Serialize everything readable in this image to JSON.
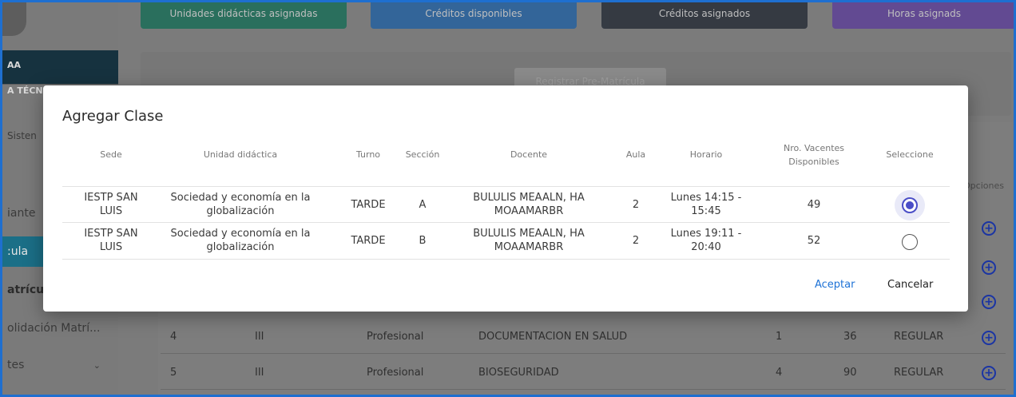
{
  "sidebar": {
    "user_name": "AA",
    "user_role": "A TÉCN",
    "system_label": "Sisten",
    "items": [
      {
        "label": "iante"
      },
      {
        "label": ":ula"
      },
      {
        "label": "atrícu"
      },
      {
        "label": "olidación Matrí..."
      },
      {
        "label": "tes"
      }
    ]
  },
  "header_cards": [
    {
      "label": "Unidades didácticas asignadas",
      "color": "#0f6b53"
    },
    {
      "label": "Créditos disponibles",
      "color": "#1b5ea3"
    },
    {
      "label": "Créditos asignados",
      "color": "#1e2530"
    },
    {
      "label": "Horas asignads",
      "color": "#5a3a9a"
    }
  ],
  "register_button": "Registrar Pre-Matrícula",
  "background_table": {
    "options_header": "Opciones",
    "rows": [
      {
        "n": "4",
        "ciclo": "III",
        "tipo": "Profesional",
        "nombre": "DOCUMENTACION EN SALUD",
        "cred": "1",
        "horas": "36",
        "estado": "REGULAR"
      },
      {
        "n": "5",
        "ciclo": "III",
        "tipo": "Profesional",
        "nombre": "BIOSEGURIDAD",
        "cred": "4",
        "horas": "90",
        "estado": "REGULAR"
      }
    ]
  },
  "modal": {
    "title": "Agregar Clase",
    "headers": {
      "sede": "Sede",
      "unidad": "Unidad didáctica",
      "turno": "Turno",
      "seccion": "Sección",
      "docente": "Docente",
      "aula": "Aula",
      "horario": "Horario",
      "vacantes_1": "Nro. Vacentes",
      "vacantes_2": "Disponibles",
      "seleccione": "Seleccione"
    },
    "rows": [
      {
        "sede_1": "IESTP SAN",
        "sede_2": "LUIS",
        "unidad_1": "Sociedad y economía en la",
        "unidad_2": "globalización",
        "turno": "TARDE",
        "seccion": "A",
        "docente_1": "BULULIS MEAALN, HA",
        "docente_2": "MOAAMARBR",
        "aula": "2",
        "horario_1": "Lunes 14:15 -",
        "horario_2": "15:45",
        "vacantes": "49",
        "selected": true
      },
      {
        "sede_1": "IESTP SAN",
        "sede_2": "LUIS",
        "unidad_1": "Sociedad y economía en la",
        "unidad_2": "globalización",
        "turno": "TARDE",
        "seccion": "B",
        "docente_1": "BULULIS MEAALN, HA",
        "docente_2": "MOAAMARBR",
        "aula": "2",
        "horario_1": "Lunes 19:11 -",
        "horario_2": "20:40",
        "vacantes": "52",
        "selected": false
      }
    ],
    "accept_label": "Aceptar",
    "cancel_label": "Cancelar"
  }
}
